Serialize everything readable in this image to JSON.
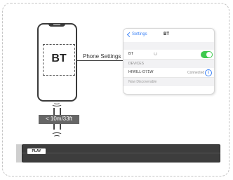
{
  "phone": {
    "screen_label": "BT",
    "connector_label": "Phone Settings"
  },
  "settings_panel": {
    "back_label": "Settings",
    "title": "BT",
    "bt_row_label": "BT",
    "bt_toggle_on": true,
    "section_devices": "DEVICES",
    "device_name": "HIWILL-D71W",
    "device_status": "Connected",
    "discoverable_text": "Now Discoverable"
  },
  "distance": {
    "label": "< 10m/33ft"
  },
  "soundbar": {
    "logo_text": "PLAY"
  },
  "colors": {
    "toggle_on": "#3ec94e",
    "link_blue": "#3b82f6",
    "device_body": "#3d3d3d"
  }
}
